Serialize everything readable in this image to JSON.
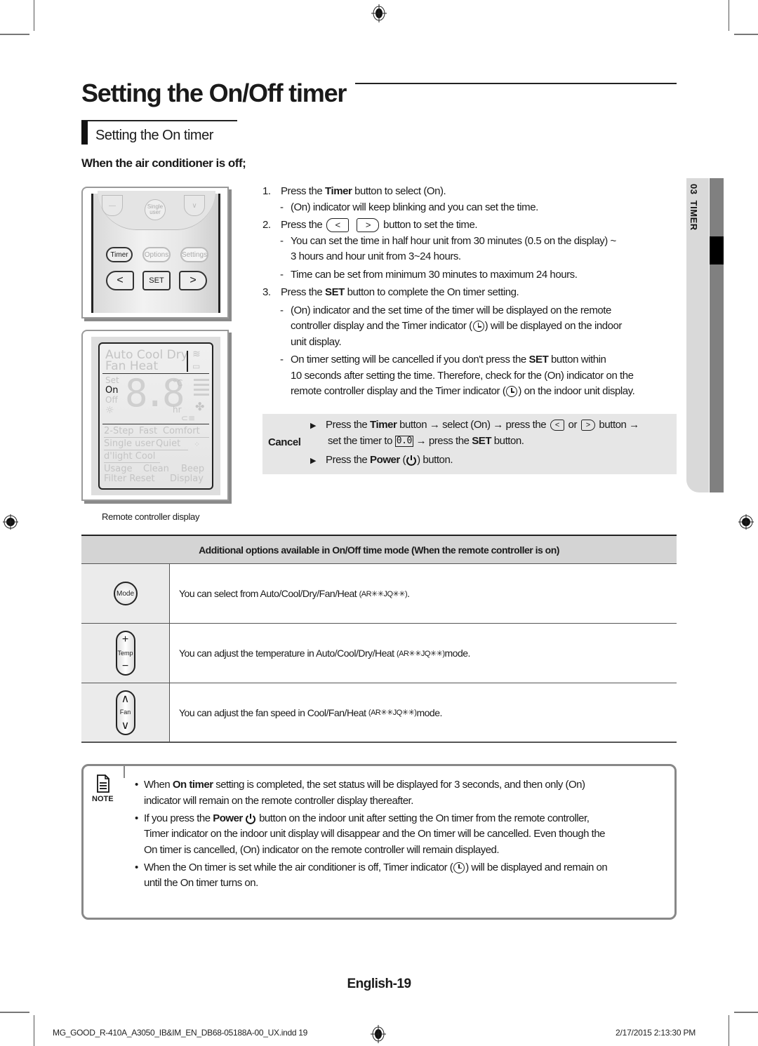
{
  "header": {
    "page_title": "Setting the On/Off timer",
    "section_title": "Setting the On timer",
    "subsection_title": "When the air conditioner is off;"
  },
  "chapter_tab": {
    "label": "03  TIMER"
  },
  "remote_buttons": {
    "single_user": "Single user",
    "timer": "Timer",
    "options": "Options",
    "settings": "Settings",
    "left": "<",
    "set": "SET",
    "right": ">"
  },
  "remote_display": {
    "modes_row1": "Auto Cool Dry",
    "modes_row2": "Fan  Heat",
    "set": "Set",
    "on": "On",
    "off": "Off",
    "digits": "8.8",
    "celsius": "°C",
    "hr": "hr",
    "row_a": [
      "2-Step",
      "Fast",
      "Comfort"
    ],
    "row_b": [
      "Single user",
      "Quiet"
    ],
    "row_c": "d'light Cool",
    "row_d": [
      "Usage",
      "Clean",
      "Beep"
    ],
    "row_e": [
      "Filter Reset",
      "Display"
    ],
    "caption": "Remote controller display"
  },
  "steps": [
    {
      "num": "1.",
      "pre": "Press the ",
      "bold": "Timer",
      "post": " button to select (On).",
      "subs": [
        "(On) indicator will keep blinking and you can set the time."
      ]
    },
    {
      "num": "2.",
      "pre": "Press the ",
      "btn_left": "<",
      "btn_right": ">",
      "post": " button to set the time.",
      "subs": [
        "You can set the time in half hour unit from 30 minutes (0.5 on the display) ~",
        "3 hours and hour unit from 3~24 hours.",
        "Time can be set from minimum 30 minutes to maximum 24 hours."
      ]
    },
    {
      "num": "3.",
      "pre": "Press the ",
      "bold": "SET",
      "post": " button to complete the On timer setting.",
      "sub1_a": "(On) indicator and the set time of the timer will be displayed on the remote",
      "sub1_b": "controller display and the Timer indicator (",
      "sub1_c": ") will be displayed on the indoor",
      "sub1_d": "unit display.",
      "sub2_a": "On timer setting will be cancelled if you don't press the ",
      "sub2_bold": "SET",
      "sub2_b": " button within",
      "sub2_c": "10 seconds after setting the time. Therefore, check for the (On) indicator on the",
      "sub2_d": "remote controller display and the Timer indicator (",
      "sub2_e": ") on the indoor unit display."
    }
  ],
  "cancel": {
    "label": "Cancel",
    "line1_a": "Press the ",
    "line1_bold": "Timer",
    "line1_b": " button → select (On) → press the ",
    "line1_or": " or ",
    "line1_c": " button →",
    "line2_a": "set the timer to ",
    "line2_digits": "0.0",
    "line2_b": " → press the ",
    "line2_bold": "SET",
    "line2_c": " button.",
    "line3_a": "Press the ",
    "line3_bold": "Power",
    "line3_b": " (",
    "line3_c": ") button.",
    "bullet": "▶"
  },
  "options_table": {
    "header": "Additional options available in On/Off time mode (When the remote controller is on)",
    "rows": [
      {
        "icon": "Mode",
        "text": "You can select from Auto/Cool/Dry/Fan/Heat ",
        "model": "(AR✳✳JQ✳✳)",
        "suffix": "."
      },
      {
        "icon": "Temp",
        "icon_top": "+",
        "icon_bottom": "−",
        "text": "You can adjust the temperature in Auto/Cool/Dry/Heat ",
        "model": "(AR✳✳JQ✳✳)",
        "suffix": " mode."
      },
      {
        "icon": "Fan",
        "icon_top": "∧",
        "icon_bottom": "∨",
        "text": "You can adjust the fan speed in Cool/Fan/Heat ",
        "model": "(AR✳✳JQ✳✳)",
        "suffix": " mode."
      }
    ]
  },
  "note": {
    "label": "NOTE",
    "bullet": "•",
    "item1_a": "When ",
    "item1_bold": "On timer",
    "item1_b": " setting is completed, the set status will be displayed for 3 seconds, and then only (On)",
    "item1_c": "indicator will remain on the remote controller display thereafter.",
    "item2_a": "If you press the ",
    "item2_bold": "Power",
    "item2_b": " button on the indoor unit after setting the On timer from the remote controller,",
    "item2_c": "Timer indicator on the indoor unit display will disappear and the On timer will be cancelled. Even though the",
    "item2_d": "On timer is cancelled, (On) indicator on the remote controller will remain displayed.",
    "item3_a": "When the On timer is set while the air conditioner is off, Timer indicator (",
    "item3_b": ") will be displayed and remain on",
    "item3_c": "until the On timer turns on."
  },
  "footer": {
    "page_number": "English-19",
    "file_name": "MG_GOOD_R-410A_A3050_IB&IM_EN_DB68-05188A-00_UX.indd  19",
    "date": "2/17/2015   2:13:30 PM"
  }
}
